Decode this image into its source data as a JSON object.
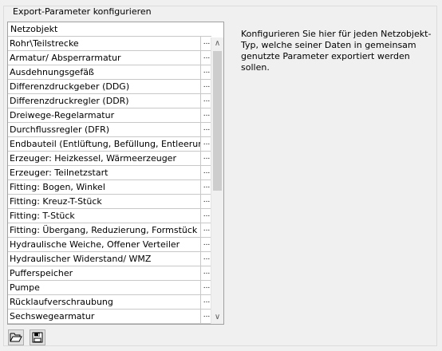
{
  "group": {
    "title": "Export-Parameter konfigurieren"
  },
  "grid": {
    "header": "Netzobjekt",
    "ellipsis": "...",
    "rows": [
      "Rohr\\Teilstrecke",
      "Armatur/ Absperrarmatur",
      "Ausdehnungsgefäß",
      "Differenzdruckgeber (DDG)",
      "Differenzdruckregler (DDR)",
      "Dreiwege-Regelarmatur",
      "Durchflussregler (DFR)",
      "Endbauteil (Entlüftung, Befüllung, Entleerung)",
      "Erzeuger: Heizkessel, Wärmeerzeuger",
      "Erzeuger: Teilnetzstart",
      "Fitting: Bogen, Winkel",
      "Fitting: Kreuz-T-Stück",
      "Fitting: T-Stück",
      "Fitting: Übergang, Reduzierung, Formstück",
      "Hydraulische Weiche, Offener Verteiler",
      "Hydraulischer Widerstand/ WMZ",
      "Pufferspeicher",
      "Pumpe",
      "Rücklaufverschraubung",
      "Sechswegearmatur"
    ],
    "scroll_up": "∧",
    "scroll_down": "∨"
  },
  "description": "Konfigurieren Sie hier für jeden Netzobjekt-Typ, welche seiner Daten in gemeinsam genutzte Parameter exportiert werden sollen.",
  "toolbar": {
    "open_icon": "folder-open-icon",
    "save_icon": "floppy-disk-icon"
  }
}
